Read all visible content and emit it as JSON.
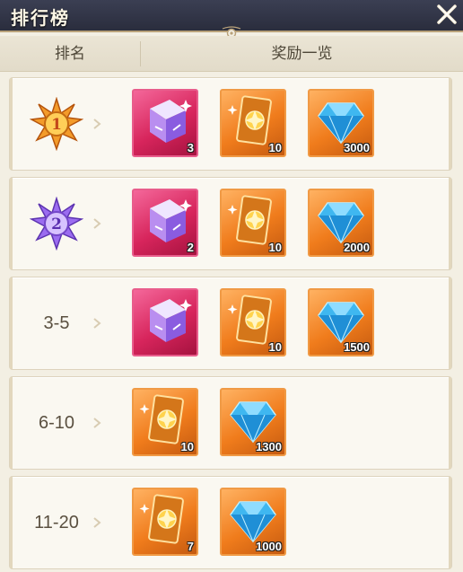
{
  "window": {
    "title": "排行榜"
  },
  "header": {
    "rank_col": "排名",
    "reward_col": "奖励一览"
  },
  "rows": [
    {
      "rank_label": "",
      "badge_number": "1",
      "items": [
        {
          "type": "cube",
          "qty": "3"
        },
        {
          "type": "card",
          "qty": "10"
        },
        {
          "type": "diamond",
          "qty": "3000"
        }
      ]
    },
    {
      "rank_label": "",
      "badge_number": "2",
      "items": [
        {
          "type": "cube",
          "qty": "2"
        },
        {
          "type": "card",
          "qty": "10"
        },
        {
          "type": "diamond",
          "qty": "2000"
        }
      ]
    },
    {
      "rank_label": "3-5",
      "items": [
        {
          "type": "cube",
          "qty": ""
        },
        {
          "type": "card",
          "qty": "10"
        },
        {
          "type": "diamond",
          "qty": "1500"
        }
      ]
    },
    {
      "rank_label": "6-10",
      "items": [
        {
          "type": "card",
          "qty": "10"
        },
        {
          "type": "diamond",
          "qty": "1300"
        }
      ]
    },
    {
      "rank_label": "11-20",
      "items": [
        {
          "type": "card",
          "qty": "7"
        },
        {
          "type": "diamond",
          "qty": "1000"
        }
      ]
    }
  ],
  "icons": {
    "close": "close-icon",
    "medal_gold": "gold-medal-icon",
    "medal_purple": "purple-medal-icon",
    "cube": "purple-cube-icon",
    "card": "gold-card-icon",
    "diamond": "blue-diamond-icon"
  },
  "colors": {
    "titlebar": "#2f3244",
    "panel": "#f3efe3",
    "pink_item": "#d7255c",
    "orange_item": "#f07c1c"
  }
}
